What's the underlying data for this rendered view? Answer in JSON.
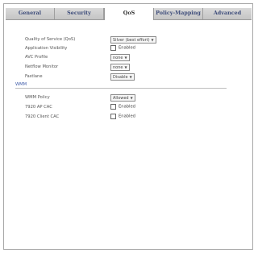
{
  "tabs": [
    {
      "label": "General"
    },
    {
      "label": "Security"
    },
    {
      "label": "QoS"
    },
    {
      "label": "Policy-Mapping"
    },
    {
      "label": "Advanced"
    }
  ],
  "fields": {
    "qos": {
      "label": "Quality of Service (QoS)",
      "value": "Silver (best effort)"
    },
    "app_visibility": {
      "label": "Application Visibility",
      "checkbox_label": "Enabled",
      "checked": false
    },
    "avc_profile": {
      "label": "AVC Profile",
      "value": "none"
    },
    "netflow_monitor": {
      "label": "Netflow Monitor",
      "value": "none"
    },
    "fastlane": {
      "label": "Fastlane",
      "value": "Disable"
    }
  },
  "section": {
    "title": "WMM"
  },
  "wmm": {
    "policy": {
      "label": "WMM Policy",
      "value": "Allowed"
    },
    "cac_7920_ap": {
      "label": "7920 AP CAC",
      "checkbox_label": "Enabled",
      "checked": false
    },
    "cac_7920_client": {
      "label": "7920 Client CAC",
      "checkbox_label": "Enabled",
      "checked": false
    }
  }
}
